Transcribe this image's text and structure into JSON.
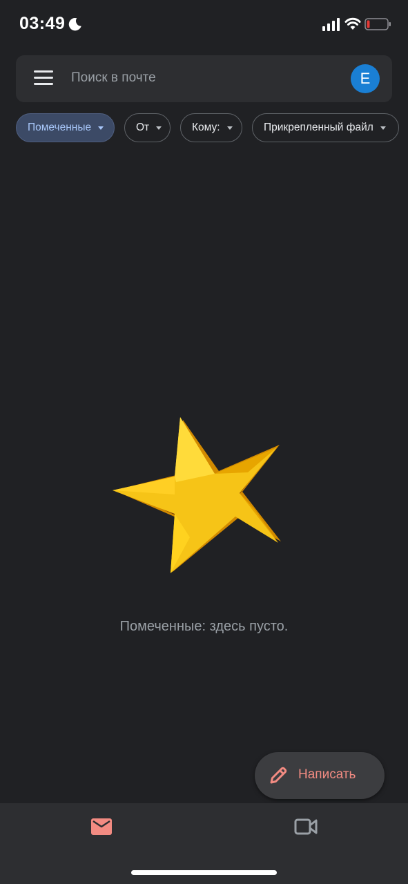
{
  "status_bar": {
    "time": "03:49",
    "icons": [
      "moon-icon",
      "signal-icon",
      "wifi-icon",
      "battery-icon"
    ],
    "battery_color": "#e53935"
  },
  "search": {
    "placeholder": "Поиск в почте",
    "avatar_letter": "E",
    "avatar_color": "#1a7fd4"
  },
  "filters": [
    {
      "label": "Помеченные",
      "active": true
    },
    {
      "label": "От",
      "active": false
    },
    {
      "label": "Кому:",
      "active": false
    },
    {
      "label": "Прикрепленный файл",
      "active": false
    }
  ],
  "empty_state": {
    "icon": "star-illustration",
    "message": "Помеченные: здесь пусто."
  },
  "fab": {
    "label": "Написать",
    "icon": "pencil-icon",
    "accent": "#f28b82"
  },
  "bottom_nav": {
    "tabs": [
      {
        "name": "mail",
        "icon": "mail-icon",
        "selected": true
      },
      {
        "name": "meet",
        "icon": "video-icon",
        "selected": false
      }
    ]
  }
}
